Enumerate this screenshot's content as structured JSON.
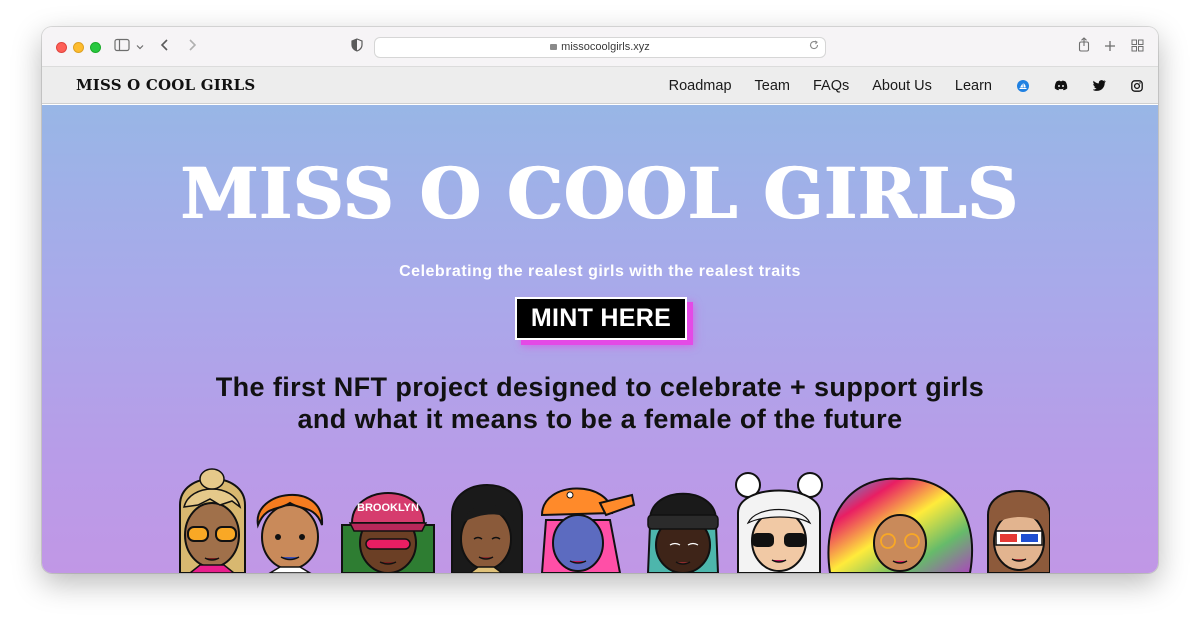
{
  "browser": {
    "url": "missocoolgirls.xyz"
  },
  "nav": {
    "brand": "MISS O COOL GIRLS",
    "links": [
      "Roadmap",
      "Team",
      "FAQs",
      "About Us",
      "Learn"
    ],
    "social_icons": [
      "opensea-icon",
      "discord-icon",
      "twitter-icon",
      "instagram-icon"
    ]
  },
  "hero": {
    "title": "MISS O COOL GIRLS",
    "subtitle": "Celebrating the realest girls with the realest traits",
    "mint_label": "MINT HERE",
    "tagline_line1": "The first NFT project designed to celebrate + support girls",
    "tagline_line2": "and what it means to be a female of the future",
    "character_cap_text": "BROOKLYN"
  },
  "colors": {
    "hero_top": "#98b6e6",
    "hero_bottom": "#c197e6",
    "mint_shadow": "#e44ae6",
    "nav_bg": "#ededed"
  }
}
